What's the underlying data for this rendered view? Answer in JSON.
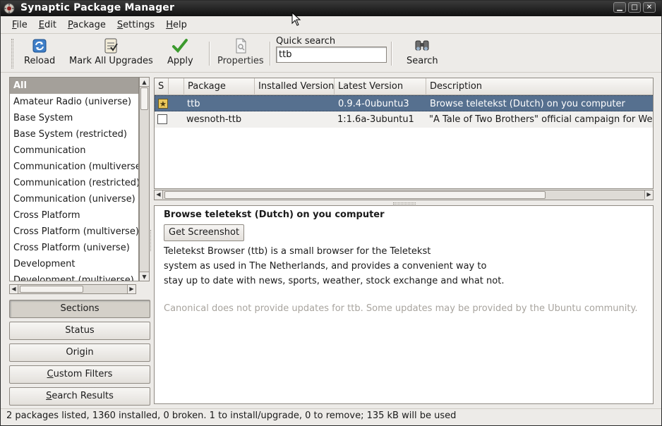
{
  "window": {
    "title": "Synaptic Package Manager",
    "controls": [
      "minimize",
      "maximize",
      "close"
    ]
  },
  "menu": [
    {
      "label": "File",
      "accel": "F",
      "rest": "ile"
    },
    {
      "label": "Edit",
      "accel": "E",
      "rest": "dit"
    },
    {
      "label": "Package",
      "accel": "P",
      "rest": "ackage"
    },
    {
      "label": "Settings",
      "accel": "S",
      "rest": "ettings"
    },
    {
      "label": "Help",
      "accel": "H",
      "rest": "elp"
    }
  ],
  "toolbar": {
    "reload": "Reload",
    "mark_all_upgrades": "Mark All Upgrades",
    "apply": "Apply",
    "properties": "Properties",
    "quick_search_label": "Quick search",
    "quick_search_value": "ttb",
    "search": "Search"
  },
  "sections": {
    "items": [
      "All",
      "Amateur Radio (universe)",
      "Base System",
      "Base System (restricted)",
      "Communication",
      "Communication (multiverse)",
      "Communication (restricted)",
      "Communication (universe)",
      "Cross Platform",
      "Cross Platform (multiverse)",
      "Cross Platform (universe)",
      "Development",
      "Development (multiverse)"
    ],
    "selected": "All"
  },
  "filter_buttons": {
    "sections": "Sections",
    "status": "Status",
    "origin": "Origin",
    "custom_filters_accel": "C",
    "custom_filters_rest": "ustom Filters",
    "search_results_accel": "S",
    "search_results_rest": "earch Results"
  },
  "table": {
    "columns": [
      "S",
      "",
      "Package",
      "Installed Version",
      "Latest Version",
      "Description"
    ],
    "rows": [
      {
        "status": "marked-install",
        "package": "ttb",
        "installed": "",
        "latest": "0.9.4-0ubuntu3",
        "description": "Browse teletekst (Dutch) on you computer",
        "selected": true
      },
      {
        "status": "not-installed",
        "package": "wesnoth-ttb",
        "installed": "",
        "latest": "1:1.6a-3ubuntu1",
        "description": "\"A Tale of Two Brothers\" official campaign for Wesnoth",
        "selected": false
      }
    ]
  },
  "details": {
    "title": "Browse teletekst (Dutch) on you computer",
    "screenshot_button": "Get Screenshot",
    "desc_lines": [
      "Teletekst Browser (ttb) is a small browser for the Teletekst",
      "system as used in The Netherlands, and provides a convenient way to",
      "stay up to date with news, sports, weather, stock exchange and what not."
    ],
    "note": "Canonical does not provide updates for ttb. Some updates may be provided by the Ubuntu community."
  },
  "status": "2 packages listed, 1360 installed, 0 broken. 1 to install/upgrade, 0 to remove; 135 kB will be used"
}
